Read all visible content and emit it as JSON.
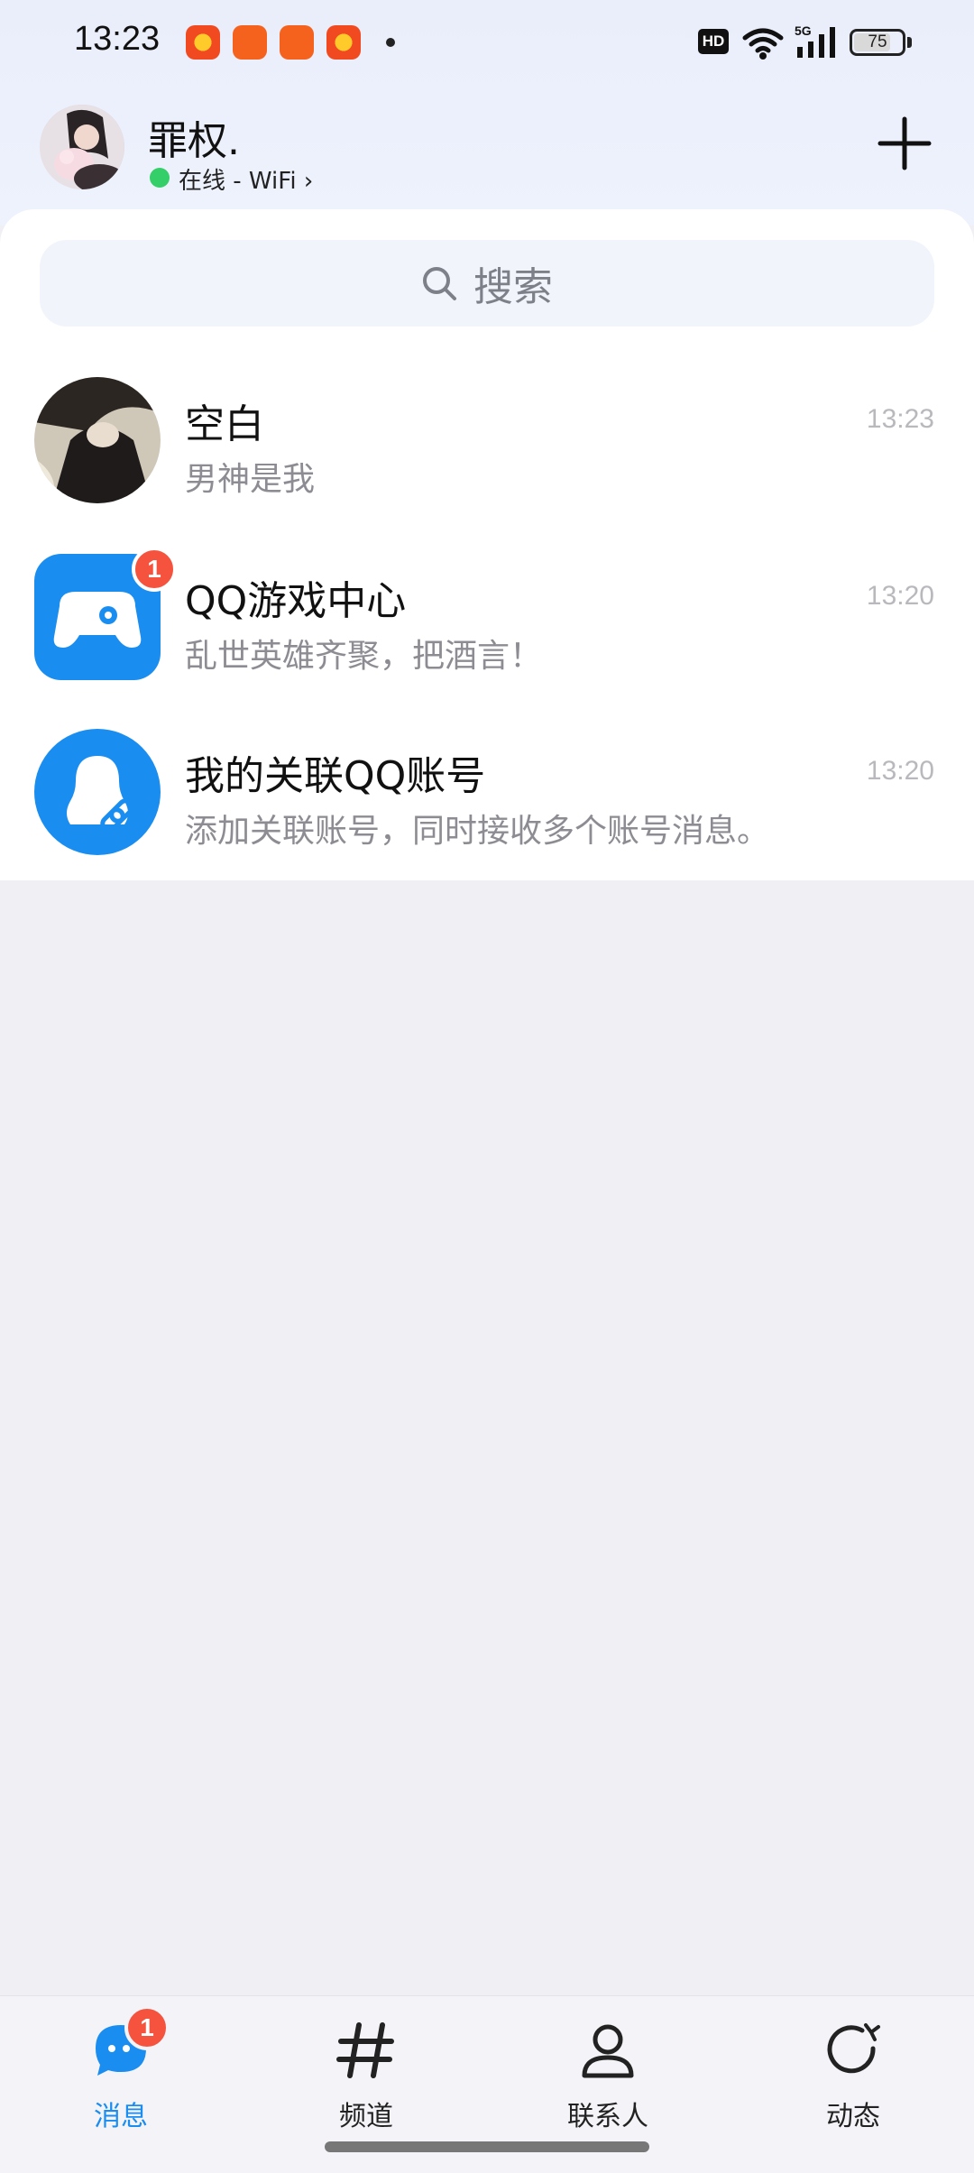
{
  "status_bar": {
    "time": "13:23",
    "network_badge": "HD",
    "signal_label": "5G",
    "battery_level": "75"
  },
  "profile": {
    "name": "罪权.",
    "status": "在线 - WiFi ›"
  },
  "search": {
    "placeholder": "搜索"
  },
  "chats": [
    {
      "name": "空白",
      "preview": "男神是我",
      "time": "13:23"
    },
    {
      "name": "QQ游戏中心",
      "preview": "乱世英雄齐聚，把酒言！",
      "time": "13:20",
      "badge": "1"
    },
    {
      "name": "我的关联QQ账号",
      "preview": "添加关联账号，同时接收多个账号消息。",
      "time": "13:20"
    }
  ],
  "nav": [
    {
      "label": "消息",
      "badge": "1",
      "active": true
    },
    {
      "label": "频道"
    },
    {
      "label": "联系人"
    },
    {
      "label": "动态"
    }
  ],
  "colors": {
    "accent": "#1a8df1",
    "badge": "#f5533d",
    "online": "#35cf6a"
  }
}
